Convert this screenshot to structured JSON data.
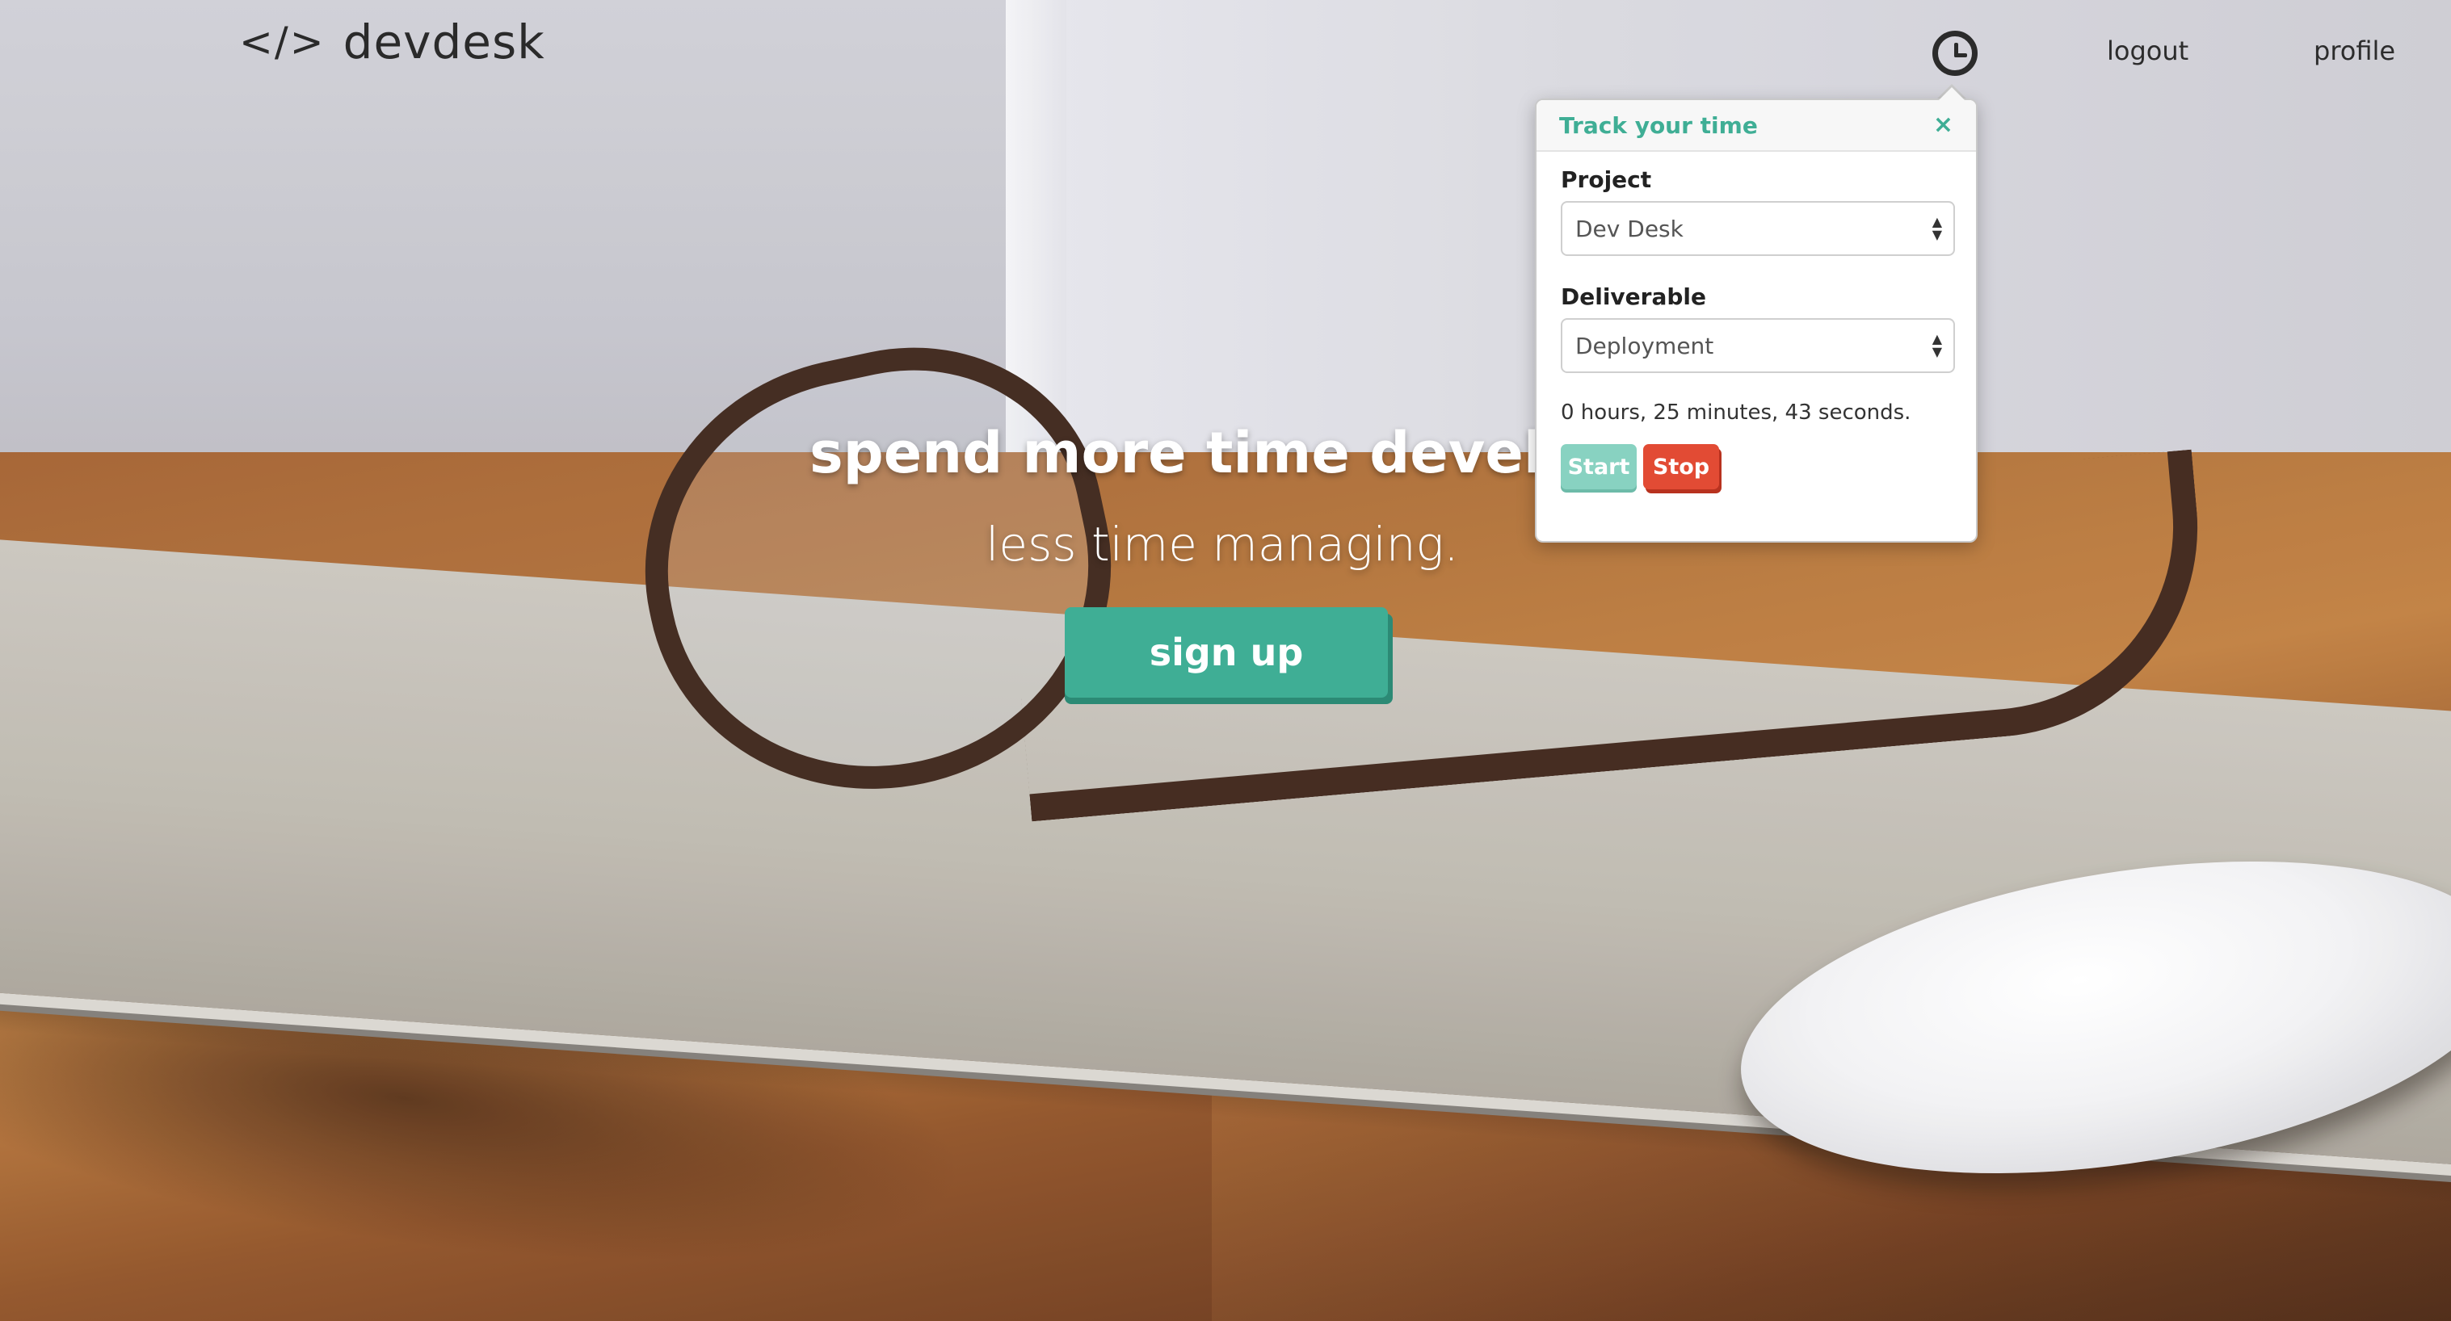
{
  "nav": {
    "brand_icon": "</>",
    "brand_name": "devdesk",
    "clock_icon": "clock-icon",
    "logout": "logout",
    "profile": "profile"
  },
  "hero": {
    "title": "spend more time develop",
    "subtitle": "less time managing.",
    "signup": "sign up"
  },
  "popover": {
    "title": "Track your time",
    "close_icon": "×",
    "project_label": "Project",
    "project_value": "Dev Desk",
    "deliverable_label": "Deliverable",
    "deliverable_value": "Deployment",
    "elapsed": "0 hours, 25 minutes, 43 seconds.",
    "start": "Start",
    "stop": "Stop"
  },
  "colors": {
    "accent": "#3fae95",
    "stop": "#e24b34"
  }
}
